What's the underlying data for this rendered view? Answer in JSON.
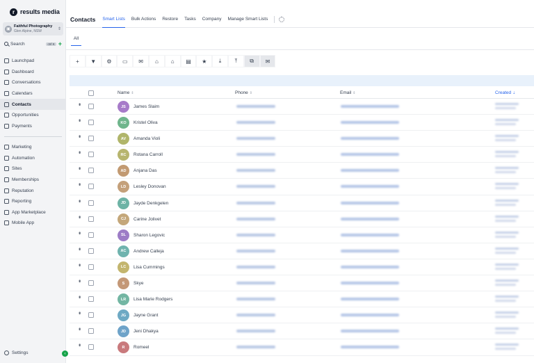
{
  "brand": {
    "logo_letter": "r",
    "name": "results media"
  },
  "account": {
    "name": "Faithful Photography",
    "location": "Glen Alpine, NSW"
  },
  "search": {
    "label": "Search",
    "shortcut": "ctrl K"
  },
  "nav_primary": [
    {
      "label": "Launchpad",
      "icon": "rocket-icon"
    },
    {
      "label": "Dashboard",
      "icon": "dashboard-icon"
    },
    {
      "label": "Conversations",
      "icon": "chat-icon"
    },
    {
      "label": "Calendars",
      "icon": "calendar-icon"
    },
    {
      "label": "Contacts",
      "icon": "contacts-icon",
      "active": true
    },
    {
      "label": "Opportunities",
      "icon": "funnel-icon"
    },
    {
      "label": "Payments",
      "icon": "payments-icon"
    }
  ],
  "nav_secondary": [
    {
      "label": "Marketing",
      "icon": "send-icon"
    },
    {
      "label": "Automation",
      "icon": "automation-icon"
    },
    {
      "label": "Sites",
      "icon": "globe-icon"
    },
    {
      "label": "Memberships",
      "icon": "memberships-icon"
    },
    {
      "label": "Reputation",
      "icon": "star-icon"
    },
    {
      "label": "Reporting",
      "icon": "chart-icon"
    },
    {
      "label": "App Marketplace",
      "icon": "grid-icon"
    },
    {
      "label": "Mobile App",
      "icon": "phone-icon"
    }
  ],
  "settings_label": "Settings",
  "header": {
    "title": "Contacts",
    "tabs": [
      "Smart Lists",
      "Bulk Actions",
      "Restore",
      "Tasks",
      "Company",
      "Manage Smart Lists"
    ],
    "active_tab": "Smart Lists"
  },
  "subtab": "All",
  "toolbar": [
    "+",
    "filter",
    "automation",
    "sms",
    "email",
    "tag-add",
    "tag-remove",
    "delete",
    "review",
    "import",
    "export",
    "merge",
    "email-verify"
  ],
  "columns": {
    "name": "Name",
    "phone": "Phone",
    "email": "Email",
    "created": "Created"
  },
  "contacts": [
    {
      "initials": "JS",
      "name": "James Slaim",
      "color": "#a77bc9"
    },
    {
      "initials": "KO",
      "name": "Kristel Oliva",
      "color": "#6fb58c"
    },
    {
      "initials": "AV",
      "name": "Amanda Violi",
      "color": "#b0b56a"
    },
    {
      "initials": "RC",
      "name": "Rotana Carroll",
      "color": "#b7b56e"
    },
    {
      "initials": "AD",
      "name": "Anjana Das",
      "color": "#c29a72"
    },
    {
      "initials": "LD",
      "name": "Lesley Donovan",
      "color": "#c4a07a"
    },
    {
      "initials": "JD",
      "name": "Jayde Denkgelen",
      "color": "#6db3a5"
    },
    {
      "initials": "CJ",
      "name": "Carine Jolivet",
      "color": "#c4a77a"
    },
    {
      "initials": "SL",
      "name": "Sharon Legovic",
      "color": "#9d7cc6"
    },
    {
      "initials": "AC",
      "name": "Andrew Calleja",
      "color": "#6fb3ae"
    },
    {
      "initials": "LC",
      "name": "Lisa Cummings",
      "color": "#c3b56e"
    },
    {
      "initials": "S",
      "name": "Skye",
      "color": "#c49877"
    },
    {
      "initials": "LR",
      "name": "Lisa Marie Rodgers",
      "color": "#73b6a3"
    },
    {
      "initials": "JG",
      "name": "Jayne Grant",
      "color": "#6ea9c4"
    },
    {
      "initials": "JD",
      "name": "Jeni Dhakya",
      "color": "#6ea3c9"
    },
    {
      "initials": "R",
      "name": "Romeel",
      "color": "#c97a7d"
    }
  ]
}
